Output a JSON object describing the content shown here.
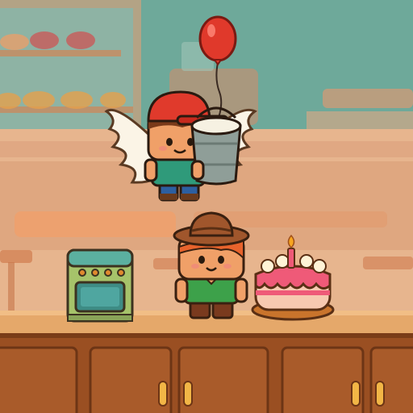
{
  "scene": {
    "type": "bakery-level",
    "palette": {
      "wall_upper": "#6ea99a",
      "wall_lower": "#e7b58e",
      "wall_mid": "#d99a74",
      "counter_top": "#e5a86a",
      "counter_front": "#9a4f22",
      "cabinet_panel": "#a95b2a",
      "cabinet_handle": "#f2b646",
      "outline": "#4a2a16"
    }
  },
  "characters": [
    {
      "role": "flying-boy",
      "hat": "red-cap",
      "carries": "bucket-of-milk",
      "wings": true,
      "balloon_color": "#e0392b"
    },
    {
      "role": "cowboy-kid",
      "hat": "cowboy-hat",
      "shirt_color": "#3da14a"
    }
  ],
  "items": [
    {
      "name": "oven",
      "color": "#a6c36a"
    },
    {
      "name": "birthday-cake",
      "color": "#ef5a78",
      "candles": 1
    }
  ]
}
